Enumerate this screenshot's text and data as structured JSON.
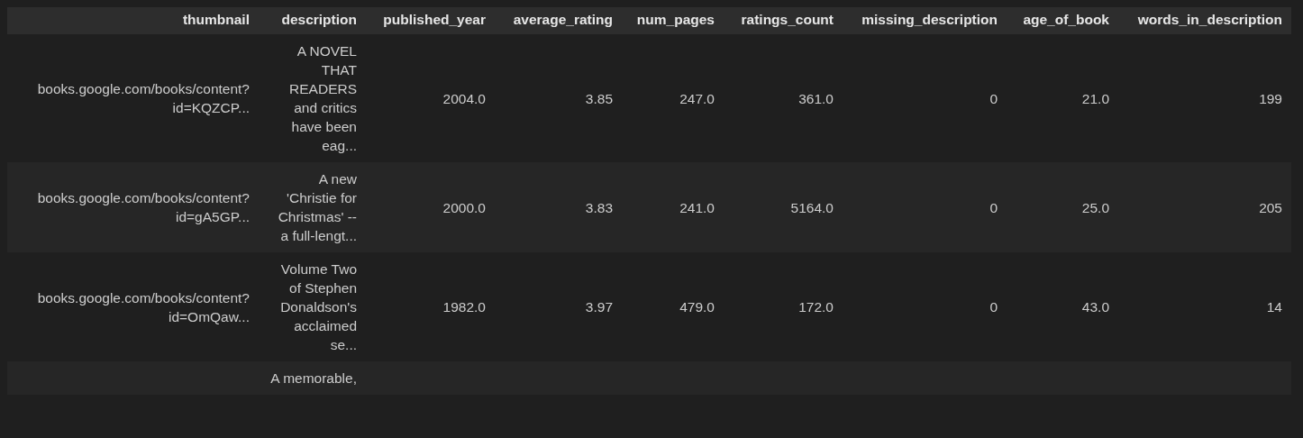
{
  "table": {
    "columns": [
      "thumbnail",
      "description",
      "published_year",
      "average_rating",
      "num_pages",
      "ratings_count",
      "missing_description",
      "age_of_book",
      "words_in_description"
    ],
    "rows": [
      {
        "cells": [
          "books.google.com/books/content?id=KQZCP...",
          "A NOVEL THAT READERS and critics have been eag...",
          "2004.0",
          "3.85",
          "247.0",
          "361.0",
          "0",
          "21.0",
          "199"
        ]
      },
      {
        "cells": [
          "books.google.com/books/content?id=gA5GP...",
          "A new 'Christie for Christmas' -- a full-lengt...",
          "2000.0",
          "3.83",
          "241.0",
          "5164.0",
          "0",
          "25.0",
          "205"
        ]
      },
      {
        "cells": [
          "books.google.com/books/content?id=OmQaw...",
          "Volume Two of Stephen Donaldson's acclaimed se...",
          "1982.0",
          "3.97",
          "479.0",
          "172.0",
          "0",
          "43.0",
          "14"
        ]
      },
      {
        "cells": [
          "",
          "A memorable,",
          "",
          "",
          "",
          "",
          "",
          "",
          ""
        ]
      }
    ]
  }
}
